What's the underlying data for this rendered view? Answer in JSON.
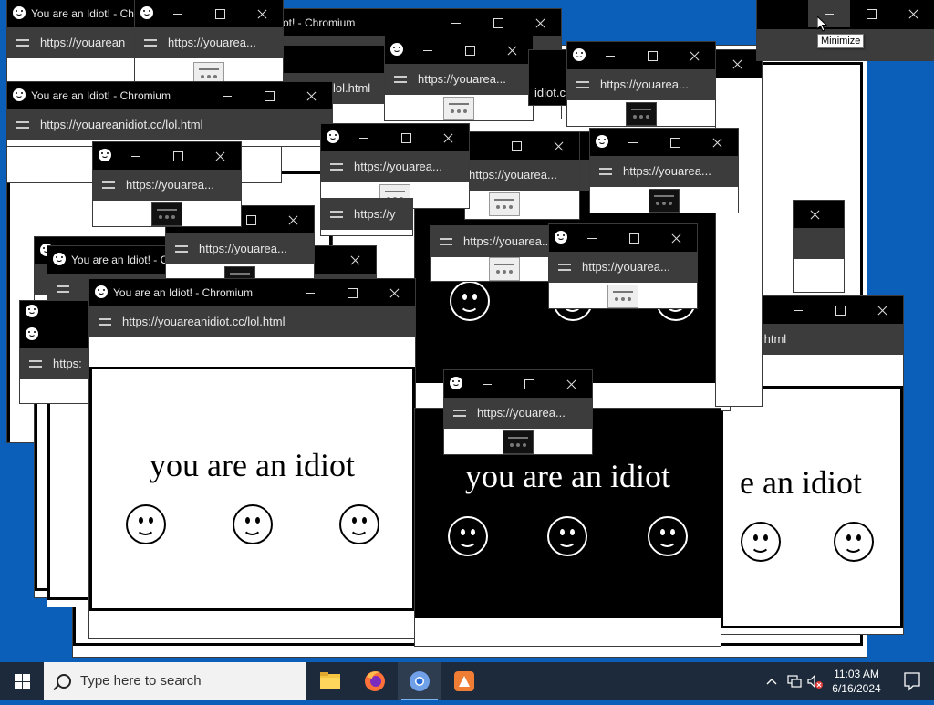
{
  "window_title_full": "You are an Idiot! - Chromium",
  "window_title_short": "You are an Idiot! - Chromium",
  "url_full": "https://youareanidiot.cc/lol.html",
  "url_short": "https://youarea...",
  "url_cut": "https://youarean",
  "url_frag_1": "lol.html",
  "url_frag_2": "idiot.cc",
  "url_frag_3": ".html",
  "url_frag_4": "https:",
  "url_frag_5": "https://y",
  "title_frag_1": "You are an Idiot! - Chr",
  "title_frag_2": "You are an Idiot! - C",
  "title_frag_3": "ot! - Chromium",
  "title_frag_4": "romium",
  "page_text": "you are an idiot",
  "page_text_cut": "e an idiot",
  "tooltip": "Minimize",
  "taskbar": {
    "search_placeholder": "Type here to search",
    "time": "11:03 AM",
    "date": "6/16/2024"
  },
  "colors": {
    "desktop": "#0b5fb8",
    "taskbar": "#1c2a3b",
    "titlebar": "#000000",
    "addressbar": "#3c3c3c"
  }
}
